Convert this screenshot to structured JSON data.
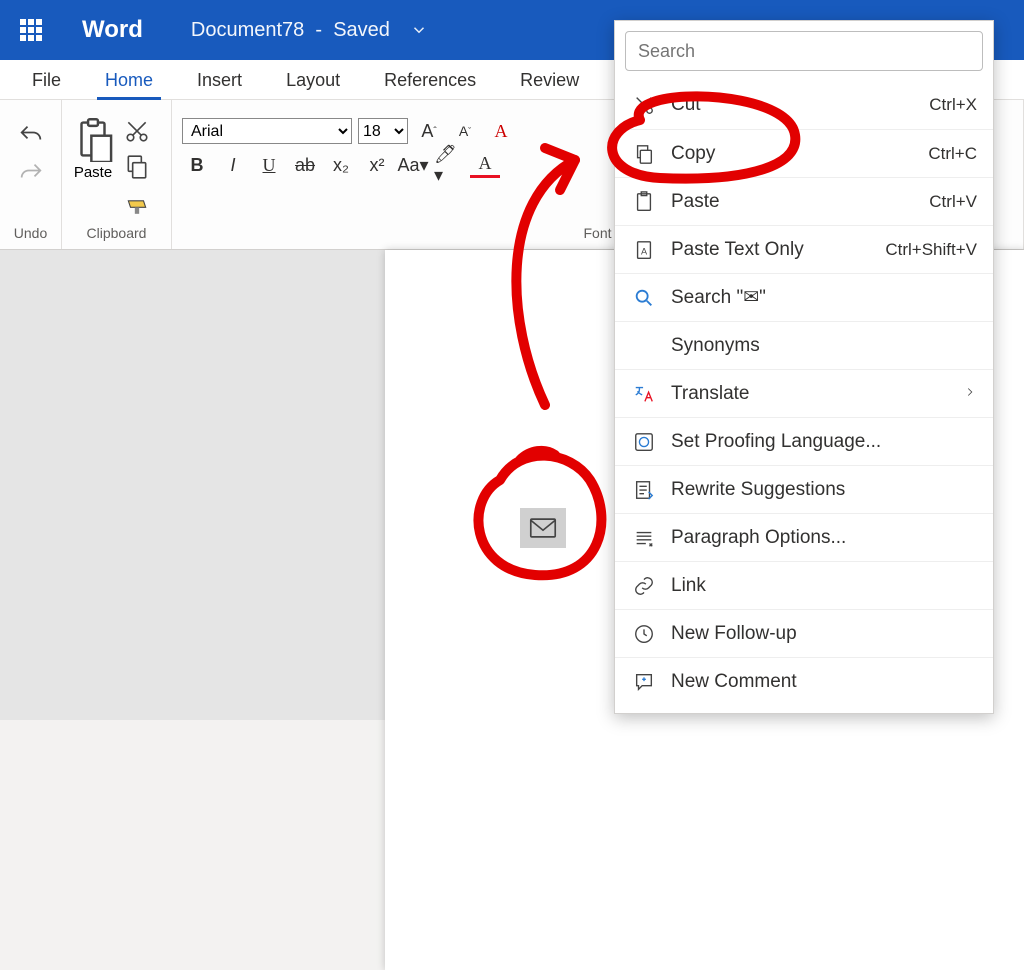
{
  "titlebar": {
    "app": "Word",
    "doc": "Document78",
    "status": "Saved"
  },
  "tabs": [
    "File",
    "Home",
    "Insert",
    "Layout",
    "References",
    "Review"
  ],
  "active_tab": "Home",
  "ribbon": {
    "undo_label": "Undo",
    "clipboard_label": "Clipboard",
    "paste_label": "Paste",
    "font_label": "Font",
    "font_name": "Arial",
    "font_size": "18",
    "buttons": {
      "bold": "B",
      "italic": "I",
      "underline": "U",
      "strike": "ab",
      "sub": "x₂",
      "sup": "x²",
      "case": "Aa",
      "grow": "A",
      "shrink": "A"
    }
  },
  "context_menu": {
    "search_placeholder": "Search",
    "items": [
      {
        "icon": "cut",
        "label": "Cut",
        "shortcut": "Ctrl+X"
      },
      {
        "icon": "copy",
        "label": "Copy",
        "shortcut": "Ctrl+C"
      },
      {
        "icon": "paste",
        "label": "Paste",
        "shortcut": "Ctrl+V"
      },
      {
        "icon": "paste-text",
        "label": "Paste Text Only",
        "shortcut": "Ctrl+Shift+V"
      },
      {
        "icon": "search",
        "label": "Search \"✉\""
      },
      {
        "icon": "",
        "label": "Synonyms"
      },
      {
        "icon": "translate",
        "label": "Translate",
        "submenu": true
      },
      {
        "icon": "language",
        "label": "Set Proofing Language..."
      },
      {
        "icon": "rewrite",
        "label": "Rewrite Suggestions"
      },
      {
        "icon": "paragraph",
        "label": "Paragraph Options..."
      },
      {
        "icon": "link",
        "label": "Link"
      },
      {
        "icon": "followup",
        "label": "New Follow-up"
      },
      {
        "icon": "comment",
        "label": "New Comment"
      }
    ]
  }
}
